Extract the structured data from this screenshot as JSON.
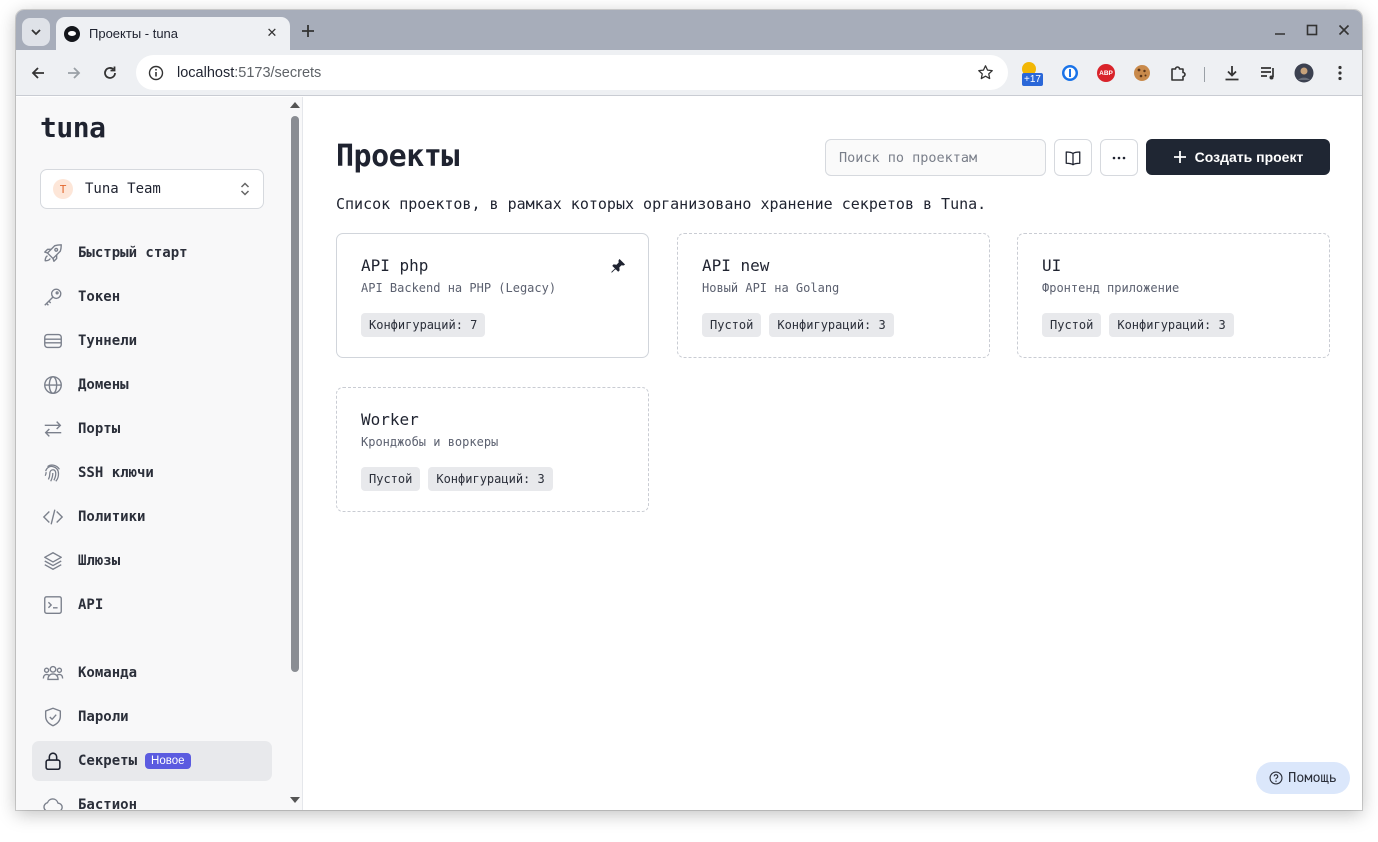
{
  "browser": {
    "tab_title": "Проекты - tuna",
    "url_host": "localhost",
    "url_path": ":5173/secrets",
    "extension_badge": "+17",
    "abp_label": "ABP"
  },
  "sidebar": {
    "logo": "tuna",
    "team": {
      "avatar": "T",
      "name": "Tuna Team"
    },
    "items": [
      {
        "label": "Быстрый старт",
        "icon": "rocket-icon"
      },
      {
        "label": "Токен",
        "icon": "key-icon"
      },
      {
        "label": "Туннели",
        "icon": "server-icon"
      },
      {
        "label": "Домены",
        "icon": "globe-icon"
      },
      {
        "label": "Порты",
        "icon": "arrows-exchange-icon"
      },
      {
        "label": "SSH ключи",
        "icon": "fingerprint-icon"
      },
      {
        "label": "Политики",
        "icon": "code-icon"
      },
      {
        "label": "Шлюзы",
        "icon": "layers-icon"
      },
      {
        "label": "API",
        "icon": "terminal-icon"
      },
      {
        "label": "Команда",
        "icon": "users-icon"
      },
      {
        "label": "Пароли",
        "icon": "shield-check-icon"
      },
      {
        "label": "Секреты",
        "icon": "lock-icon",
        "badge": "Новое",
        "active": true
      },
      {
        "label": "Бастион",
        "icon": "cloud-icon"
      }
    ]
  },
  "main": {
    "title": "Проекты",
    "search_placeholder": "Поиск по проектам",
    "create_label": "Создать проект",
    "subtitle": "Список проектов, в рамках которых организовано хранение секретов в Tuna.",
    "projects": [
      {
        "name": "API php",
        "description": "API Backend на PHP (Legacy)",
        "tags": [
          "Конфигураций: 7"
        ],
        "pinned": true
      },
      {
        "name": "API new",
        "description": "Новый API на Golang",
        "tags": [
          "Пустой",
          "Конфигураций: 3"
        ],
        "pinned": false
      },
      {
        "name": "UI",
        "description": "Фронтенд приложение",
        "tags": [
          "Пустой",
          "Конфигураций: 3"
        ],
        "pinned": false
      },
      {
        "name": "Worker",
        "description": "Кронджобы и воркеры",
        "tags": [
          "Пустой",
          "Конфигураций: 3"
        ],
        "pinned": false
      }
    ],
    "help_label": "Помощь"
  },
  "colors": {
    "primary_button": "#1f2633",
    "badge_new": "#5b5be0",
    "help_button": "#dbe7fb"
  }
}
